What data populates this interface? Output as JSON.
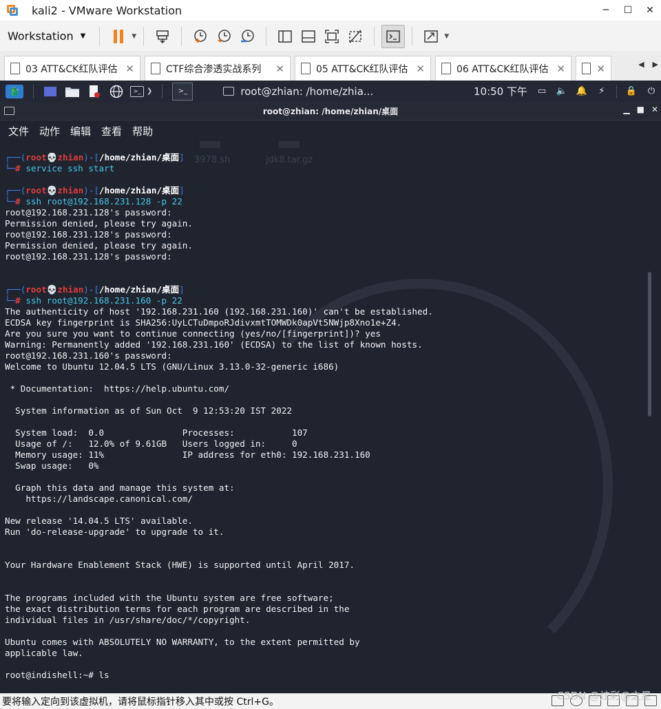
{
  "window": {
    "title": "kali2 - VMware Workstation",
    "minimize": "─",
    "maximize": "☐",
    "close": "✕"
  },
  "toolbar": {
    "workstation_menu": "Workstation",
    "caret": "▼",
    "buttons": [
      "pause",
      "send-ctrl-alt-del",
      "snapshot-take",
      "snapshot-revert",
      "snapshot-manager",
      "view-sidebar",
      "view-library",
      "full-screen",
      "unity",
      "console-view",
      "stretch"
    ]
  },
  "tabs": [
    {
      "label": "03 ATT&CK红队评估"
    },
    {
      "label": "CTF综合渗透实战系列"
    },
    {
      "label": "05 ATT&CK红队评估"
    },
    {
      "label": "06 ATT&CK红队评估"
    },
    {
      "label": ""
    }
  ],
  "tab_close": "✕",
  "tab_nav": {
    "prev": "◀",
    "next": "▶"
  },
  "kali_panel": {
    "task_title": "root@zhian: /home/zhia...",
    "clock": "10:50 下午",
    "terminal_btn_label": ">_"
  },
  "terminal": {
    "title": "root@zhian: /home/zhian/桌面",
    "menu": [
      "文件",
      "动作",
      "编辑",
      "查看",
      "帮助"
    ],
    "controls": {
      "min": "▁",
      "max": "■",
      "close": "✕"
    },
    "prompt_user": "root",
    "prompt_skull": "💀",
    "prompt_host": "zhian",
    "prompt_path": "/home/zhian/桌面",
    "commands": [
      "service ssh start",
      "ssh root@192.168.231.128 -p 22",
      "ssh root@192.168.231.160 -p 22"
    ],
    "output_block1": [
      "root@192.168.231.128's password:",
      "Permission denied, please try again.",
      "root@192.168.231.128's password:",
      "Permission denied, please try again.",
      "root@192.168.231.128's password:"
    ],
    "output_block2": [
      "The authenticity of host '192.168.231.160 (192.168.231.160)' can't be established.",
      "ECDSA key fingerprint is SHA256:UyLCTuDmpoRJdivxmtTOMWDk0apVt5NWjp8Xno1e+Z4.",
      "Are you sure you want to continue connecting (yes/no/[fingerprint])? yes",
      "Warning: Permanently added '192.168.231.160' (ECDSA) to the list of known hosts.",
      "root@192.168.231.160's password:",
      "Welcome to Ubuntu 12.04.5 LTS (GNU/Linux 3.13.0-32-generic i686)",
      "",
      " * Documentation:  https://help.ubuntu.com/",
      "",
      "  System information as of Sun Oct  9 12:53:20 IST 2022",
      "",
      "  System load:  0.0               Processes:           107",
      "  Usage of /:   12.0% of 9.61GB   Users logged in:     0",
      "  Memory usage: 11%               IP address for eth0: 192.168.231.160",
      "  Swap usage:   0%",
      "",
      "  Graph this data and manage this system at:",
      "    https://landscape.canonical.com/",
      "",
      "New release '14.04.5 LTS' available.",
      "Run 'do-release-upgrade' to upgrade to it.",
      "",
      "",
      "Your Hardware Enablement Stack (HWE) is supported until April 2017.",
      "",
      "",
      "The programs included with the Ubuntu system are free software;",
      "the exact distribution terms for each program are described in the",
      "individual files in /usr/share/doc/*/copyright.",
      "",
      "Ubuntu comes with ABSOLUTELY NO WARRANTY, to the extent permitted by",
      "applicable law.",
      "",
      "root@indishell:~# ls"
    ],
    "desktop_bg_files": [
      "3978.sh",
      "jdk8.tar.gz"
    ]
  },
  "statusbar": {
    "message": "要将输入定向到该虚拟机，请将鼠标指针移入其中或按 Ctrl+G。",
    "watermark": "CSDN @炫彩@之星"
  }
}
